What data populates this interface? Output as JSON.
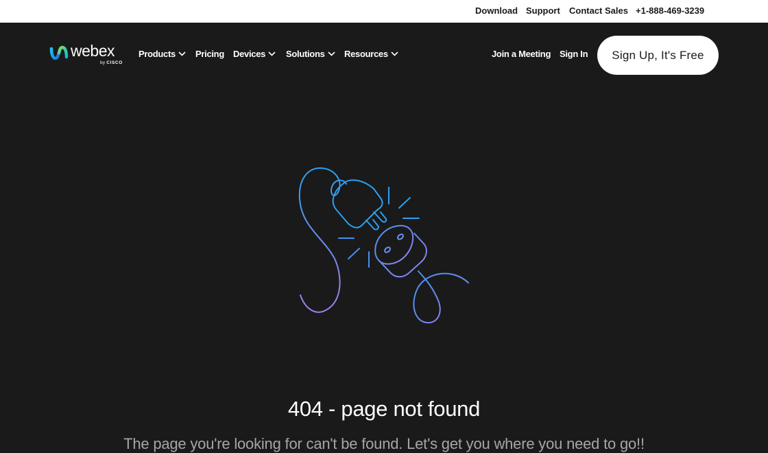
{
  "utility_bar": {
    "download": "Download",
    "support": "Support",
    "contact_sales": "Contact Sales",
    "phone": "+1-888-469-3239"
  },
  "logo": {
    "wordmark": "webex",
    "by": "by",
    "brand": "CISCO"
  },
  "nav": {
    "products": "Products",
    "pricing": "Pricing",
    "devices": "Devices",
    "solutions": "Solutions",
    "resources": "Resources",
    "join_meeting": "Join a Meeting",
    "sign_in": "Sign In",
    "sign_up": "Sign Up, It's Free"
  },
  "error": {
    "title": "404 - page not found",
    "message": "The page you're looking for can't be found. Let's get you where you need to go!!"
  },
  "icons": {
    "logo_mark": "webex-logo-icon",
    "chevron": "chevron-down-icon",
    "illustration": "unplugged-cable-icon"
  },
  "colors": {
    "background": "#1a1a1a",
    "utility_bar": "#ffffff",
    "text": "#ffffff",
    "muted_text": "#a6a6a6",
    "illustration_blue": "#2aa1f2",
    "illustration_purple": "#a67cf0"
  }
}
